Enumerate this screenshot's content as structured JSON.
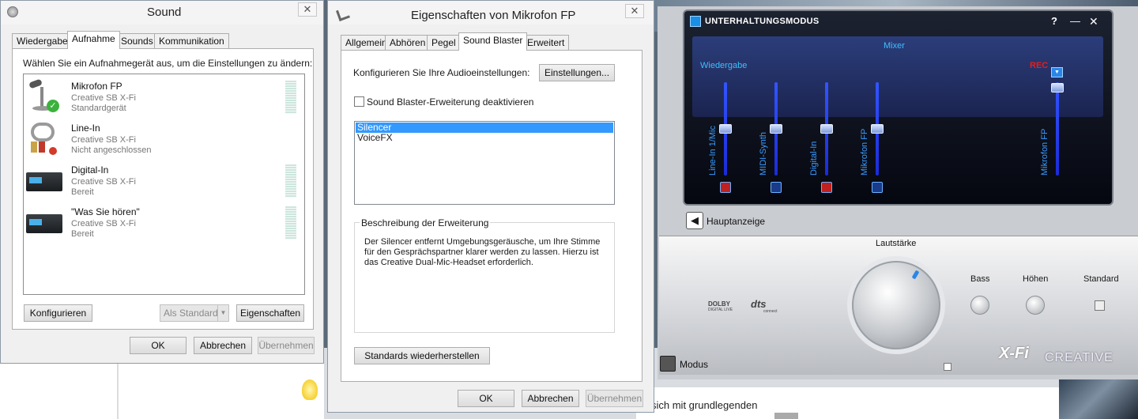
{
  "sound": {
    "title": "Sound",
    "tabs": [
      "Wiedergabe",
      "Aufnahme",
      "Sounds",
      "Kommunikation"
    ],
    "instruction": "Wählen Sie ein Aufnahmegerät aus, um die Einstellungen zu ändern:",
    "devices": [
      {
        "name": "Mikrofon FP",
        "sub1": "Creative SB X-Fi",
        "sub2": "Standardgerät",
        "icon": "microphone-icon",
        "badge": "check-badge-icon"
      },
      {
        "name": "Line-In",
        "sub1": "Creative SB X-Fi",
        "sub2": "Nicht angeschlossen",
        "icon": "cable-icon",
        "badge": "disconnected-badge-icon"
      },
      {
        "name": "Digital-In",
        "sub1": "Creative SB X-Fi",
        "sub2": "Bereit",
        "icon": "soundcard-icon"
      },
      {
        "name": "\"Was Sie hören\"",
        "sub1": "Creative SB X-Fi",
        "sub2": "Bereit",
        "icon": "soundcard-icon"
      }
    ],
    "buttons": {
      "configure": "Konfigurieren",
      "set_default": "Als Standard",
      "properties": "Eigenschaften",
      "ok": "OK",
      "cancel": "Abbrechen",
      "apply": "Übernehmen"
    }
  },
  "props": {
    "title": "Eigenschaften von Mikrofon FP",
    "tabs": [
      "Allgemein",
      "Abhören",
      "Pegel",
      "Sound Blaster",
      "Erweitert"
    ],
    "configure_label": "Konfigurieren Sie Ihre Audioeinstellungen:",
    "settings_button": "Einstellungen...",
    "disable_checkbox": "Sound Blaster-Erweiterung deaktivieren",
    "list": [
      "Silencer",
      "VoiceFX"
    ],
    "desc_group": "Beschreibung der Erweiterung",
    "desc_text": "Der Silencer entfernt Umgebungsgeräusche, um Ihre Stimme für den Gesprächspartner klarer werden zu lassen. Hierzu ist das Creative Dual-Mic-Headset erforderlich.",
    "restore_button": "Standards wiederherstellen",
    "buttons": {
      "ok": "OK",
      "cancel": "Abbrechen",
      "apply": "Übernehmen"
    }
  },
  "creative": {
    "title": "UNTERHALTUNGSMODUS",
    "help": "?",
    "minimize": "—",
    "close": "✕",
    "mixer": "Mixer",
    "playback": "Wiedergabe",
    "rec": "REC",
    "channels": [
      "Line-In 1/Mic",
      "MIDI-Synth",
      "Digital-In",
      "Mikrofon FP"
    ],
    "rec_channel": "Mikrofon FP",
    "main_display": "Hauptanzeige",
    "volume": "Lautstärke",
    "bass": "Bass",
    "treble": "Höhen",
    "standard": "Standard",
    "dolby": "DOLBY",
    "dolby_sub": "DIGITAL LIVE",
    "dts": "dts",
    "dts_sub": "connect",
    "mode": "Modus",
    "xfi": "X-Fi",
    "brand": "CREATIVE"
  },
  "background": {
    "snippet": "sich mit grundlegenden"
  }
}
